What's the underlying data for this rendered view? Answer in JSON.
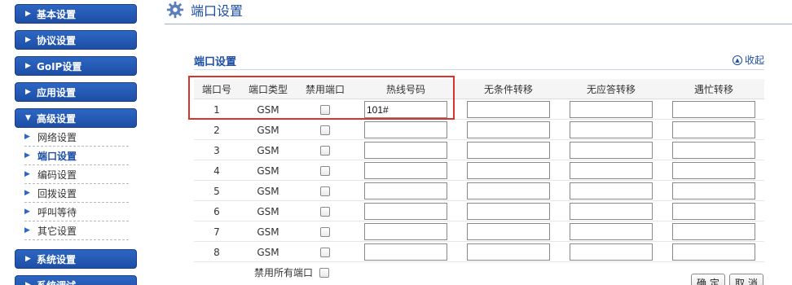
{
  "sidebar": {
    "items": [
      {
        "label": "基本设置"
      },
      {
        "label": "协议设置"
      },
      {
        "label": "GoIP设置"
      },
      {
        "label": "应用设置"
      },
      {
        "label": "高级设置"
      },
      {
        "label": "系统设置"
      },
      {
        "label": "系统调试"
      }
    ],
    "sub_items": [
      {
        "label": "网络设置"
      },
      {
        "label": "端口设置"
      },
      {
        "label": "编码设置"
      },
      {
        "label": "回拨设置"
      },
      {
        "label": "呼叫等待"
      },
      {
        "label": "其它设置"
      }
    ],
    "active_sub": "端口设置"
  },
  "header": {
    "title": "端口设置",
    "icon": "gear-icon"
  },
  "section": {
    "title": "端口设置",
    "collapse_label": "收起",
    "collapse_icon": "collapse-up-icon"
  },
  "table": {
    "columns": [
      "端口号",
      "端口类型",
      "禁用端口",
      "热线号码",
      "无条件转移",
      "无应答转移",
      "遇忙转移"
    ],
    "rows": [
      {
        "port": "1",
        "type": "GSM",
        "disabled": false,
        "hotline": "101#",
        "unconditional": "",
        "no_answer": "",
        "busy": ""
      },
      {
        "port": "2",
        "type": "GSM",
        "disabled": false,
        "hotline": "",
        "unconditional": "",
        "no_answer": "",
        "busy": ""
      },
      {
        "port": "3",
        "type": "GSM",
        "disabled": false,
        "hotline": "",
        "unconditional": "",
        "no_answer": "",
        "busy": ""
      },
      {
        "port": "4",
        "type": "GSM",
        "disabled": false,
        "hotline": "",
        "unconditional": "",
        "no_answer": "",
        "busy": ""
      },
      {
        "port": "5",
        "type": "GSM",
        "disabled": false,
        "hotline": "",
        "unconditional": "",
        "no_answer": "",
        "busy": ""
      },
      {
        "port": "6",
        "type": "GSM",
        "disabled": false,
        "hotline": "",
        "unconditional": "",
        "no_answer": "",
        "busy": ""
      },
      {
        "port": "7",
        "type": "GSM",
        "disabled": false,
        "hotline": "",
        "unconditional": "",
        "no_answer": "",
        "busy": ""
      },
      {
        "port": "8",
        "type": "GSM",
        "disabled": false,
        "hotline": "",
        "unconditional": "",
        "no_answer": "",
        "busy": ""
      }
    ],
    "disable_all_label": "禁用所有端口"
  },
  "buttons": {
    "ok": "确 定",
    "cancel": "取 消"
  },
  "colors": {
    "nav_blue": "#1d4ea6",
    "highlight": "#d9332e"
  }
}
